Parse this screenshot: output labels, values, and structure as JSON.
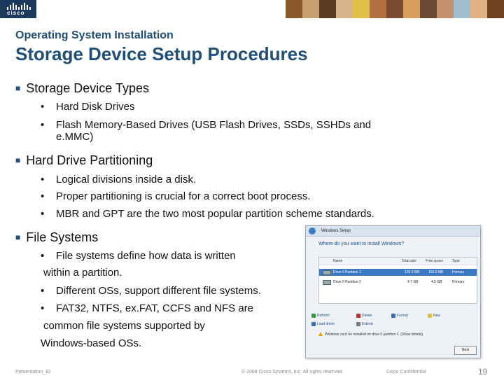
{
  "header": {
    "logo_text": "cisco",
    "photo_colors": [
      "#8b5a2b",
      "#c8a070",
      "#5a3a20",
      "#d9b48a",
      "#e2c04a",
      "#b07040",
      "#7a4a30",
      "#d7a060",
      "#6b4a35",
      "#c49070",
      "#a0c0d0",
      "#e0b080",
      "#704020"
    ]
  },
  "slide": {
    "subtitle": "Operating System Installation",
    "title": "Storage Device Setup Procedures",
    "sections": [
      {
        "heading": "Storage Device Types",
        "items": [
          "Hard Disk Drives",
          "Flash Memory-Based Drives (USB Flash Drives, SSDs, SSHDs and",
          "e.MMC)"
        ]
      },
      {
        "heading": "Hard Drive Partitioning",
        "items": [
          "Logical divisions inside a disk.",
          "Proper partitioning is crucial for a correct boot process.",
          "MBR and GPT are the two most popular partition scheme standards."
        ]
      },
      {
        "heading": "File Systems",
        "items": [
          "File systems define how data is written",
          "within a partition.",
          "Different OSs, support different file systems.",
          "FAT32, NTFS, ex.FAT, CCFS and NFS are",
          "common file systems supported by",
          "Windows-based OSs."
        ]
      }
    ]
  },
  "windows_setup": {
    "window_title": "Windows Setup",
    "question": "Where do you want to install Windows?",
    "columns": [
      "Name",
      "Total size",
      "Free space",
      "Type"
    ],
    "rows": [
      {
        "name": "Drive 0 Partition 1",
        "total": "150.0 MB",
        "free": "150.0 MB",
        "type": "Primary"
      },
      {
        "name": "Drive 0 Partition 2",
        "total": "4.7 GB",
        "free": "4.5 GB",
        "type": "Primary"
      }
    ],
    "actions": [
      "Refresh",
      "Delete",
      "Format",
      "New",
      "Load driver",
      "Extend"
    ],
    "warning": "Windows can't be installed on drive 0 partition 1. (Show details)",
    "next_label": "Next"
  },
  "footer": {
    "left": "Presentation_ID",
    "center": "© 2008 Cisco Systems, Inc. All rights reserved.",
    "right": "Cisco Confidential",
    "page": "19"
  }
}
